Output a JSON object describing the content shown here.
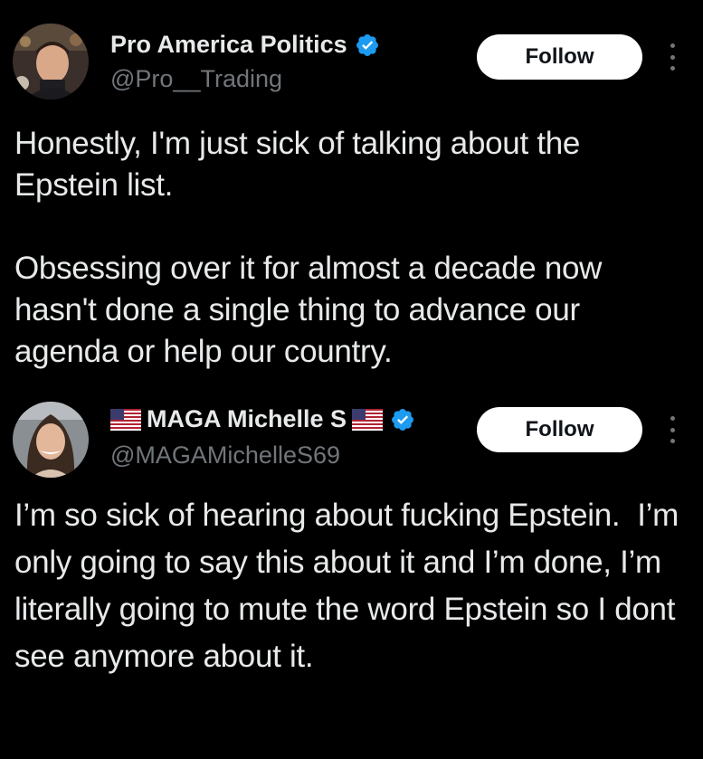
{
  "tweets": [
    {
      "display_name": "Pro America Politics",
      "handle": "@Pro__Trading",
      "follow_label": "Follow",
      "verified": true,
      "text": "Honestly, I'm just sick of talking about the Epstein list.\n\nObsessing over it for almost a decade now hasn't done a single thing to advance our agenda or help our country."
    },
    {
      "display_name": "MAGA Michelle S",
      "handle": "@MAGAMichelleS69",
      "follow_label": "Follow",
      "verified": true,
      "name_flags": "us-flag",
      "text": "I’m so sick of hearing about fucking Epstein.  I’m only going to say this about it and I’m done, I’m literally going to mute the word Epstein so I dont see anymore about it."
    }
  ],
  "colors": {
    "background": "#000000",
    "text": "#e7e9ea",
    "secondary_text": "#71767b",
    "verified_blue": "#1d9bf0",
    "follow_bg": "#ffffff"
  }
}
